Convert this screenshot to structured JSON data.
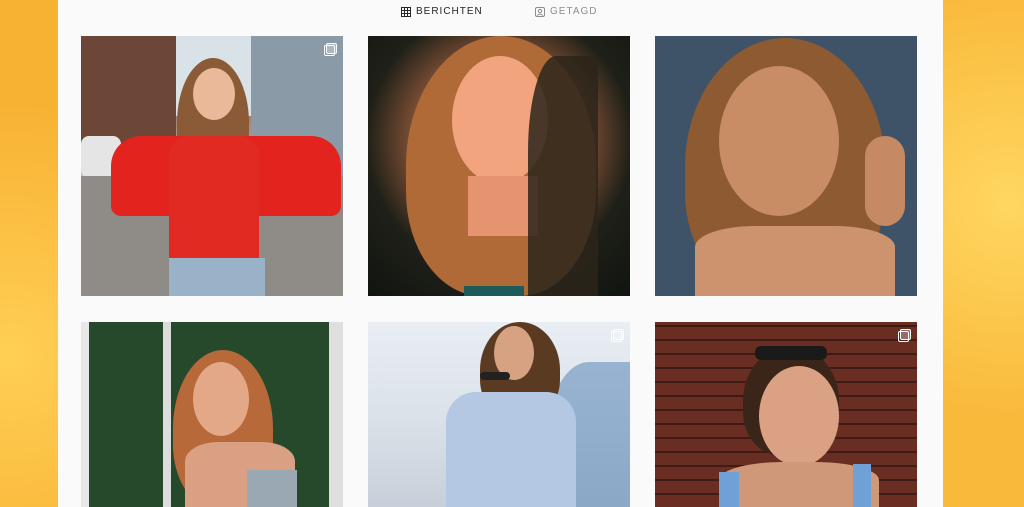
{
  "tabs": [
    {
      "label": "BERICHTEN",
      "icon": "grid-icon",
      "active": true
    },
    {
      "label": "GETAGD",
      "icon": "tagged-icon",
      "active": false
    }
  ],
  "posts": [
    {
      "description_icon": "photo",
      "multi": true
    },
    {
      "description_icon": "photo",
      "multi": false
    },
    {
      "description_icon": "photo",
      "multi": false
    },
    {
      "description_icon": "photo",
      "multi": false
    },
    {
      "description_icon": "photo",
      "multi": true
    },
    {
      "description_icon": "photo",
      "multi": true
    }
  ],
  "colors": {
    "background": "#fbc343",
    "panel": "#fafafa",
    "tab_active": "#262626",
    "tab_inactive": "#8e8e8e"
  }
}
